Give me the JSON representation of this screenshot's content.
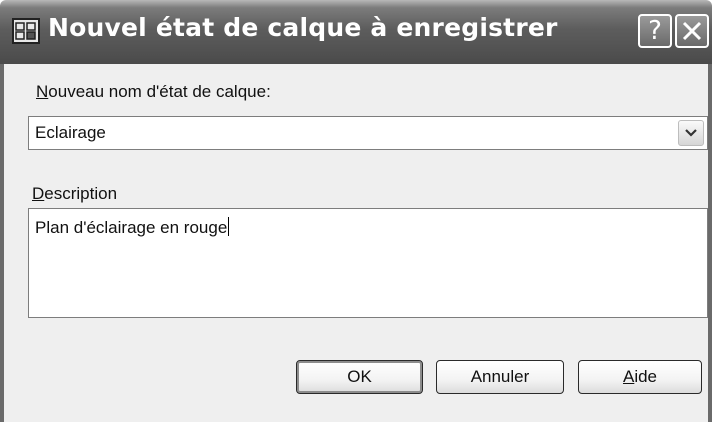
{
  "window": {
    "title": "Nouvel état de calque à enregistrer",
    "app_icon": "layer-state-icon",
    "help_button_glyph": "?",
    "close_icon": "close-icon"
  },
  "form": {
    "name_label_accel": "N",
    "name_label_rest": "ouveau nom d'état de calque:",
    "name_value": "Eclairage",
    "dropdown_icon": "chevron-down-icon",
    "description_label_accel": "D",
    "description_label_rest": "escription",
    "description_value": "Plan d'éclairage en rouge"
  },
  "buttons": {
    "ok": "OK",
    "cancel": "Annuler",
    "help_accel": "A",
    "help_rest": "ide"
  },
  "colors": {
    "titlebar": "#5d5d5d",
    "dialog_bg": "#efefef",
    "field_bg": "#ffffff"
  }
}
